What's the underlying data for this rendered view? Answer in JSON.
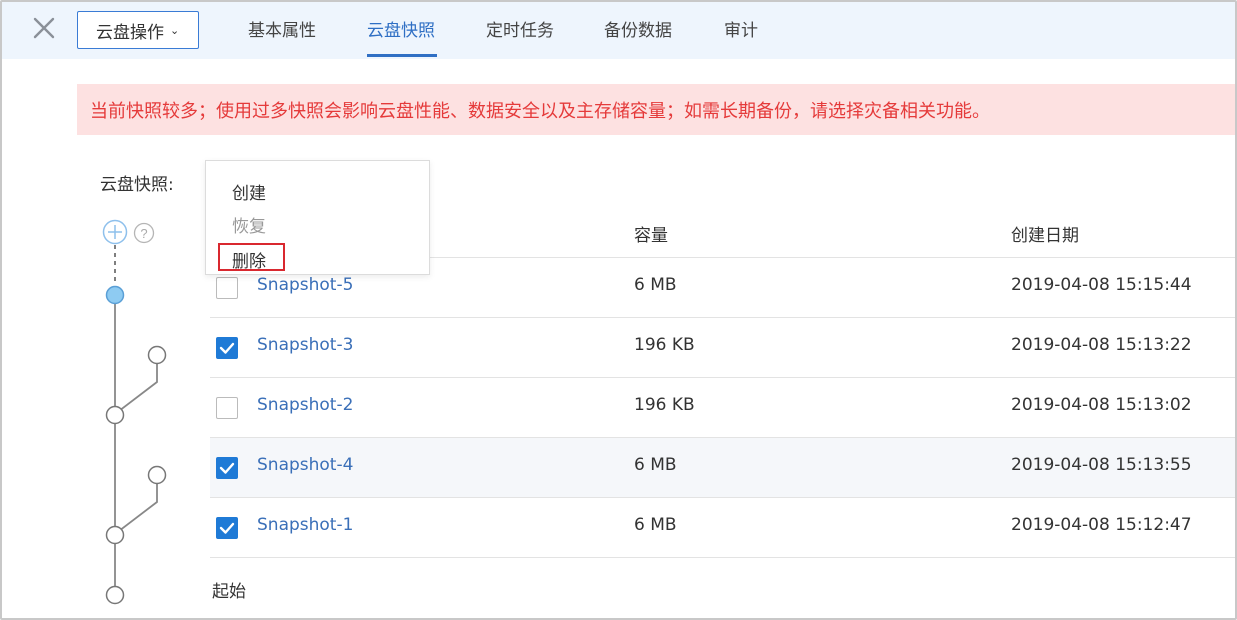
{
  "toolbar": {
    "ops_label": "云盘操作"
  },
  "tabs": [
    {
      "label": "基本属性"
    },
    {
      "label": "云盘快照"
    },
    {
      "label": "定时任务"
    },
    {
      "label": "备份数据"
    },
    {
      "label": "审计"
    }
  ],
  "warning": "当前快照较多；使用过多快照会影响云盘性能、数据安全以及主存储容量；如需长期备份，请选择灾备相关功能。",
  "snapshot_label": "云盘快照:",
  "menu": {
    "items": [
      {
        "label": "创建",
        "enabled": true
      },
      {
        "label": "恢复",
        "enabled": false
      },
      {
        "label": "删除",
        "enabled": true
      }
    ]
  },
  "table": {
    "columns": [
      "容量",
      "创建日期"
    ],
    "rows": [
      {
        "name": "Snapshot-5",
        "capacity": "6 MB",
        "date": "2019-04-08 15:15:44",
        "checked": false
      },
      {
        "name": "Snapshot-3",
        "capacity": "196 KB",
        "date": "2019-04-08 15:13:22",
        "checked": true
      },
      {
        "name": "Snapshot-2",
        "capacity": "196 KB",
        "date": "2019-04-08 15:13:02",
        "checked": false
      },
      {
        "name": "Snapshot-4",
        "capacity": "6 MB",
        "date": "2019-04-08 15:13:55",
        "checked": true
      },
      {
        "name": "Snapshot-1",
        "capacity": "6 MB",
        "date": "2019-04-08 15:12:47",
        "checked": true
      }
    ],
    "origin_label": "起始"
  },
  "colors": {
    "accent": "#2f6fc4",
    "link": "#3a6fb8",
    "checkbox": "#1f7ad6",
    "warning_bg": "#fde1e1",
    "warning_text": "#e53a3a",
    "current_node": "#8ecbf2"
  },
  "icons": {
    "close": "close-icon",
    "add": "plus-circle-icon",
    "help": "question-circle-icon",
    "chevron": "chevron-down-icon"
  }
}
